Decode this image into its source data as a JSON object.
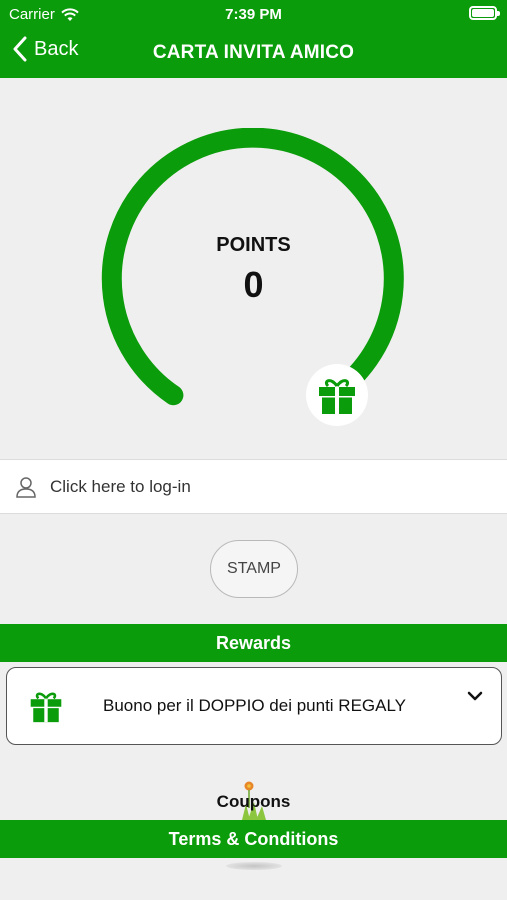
{
  "status_bar": {
    "carrier": "Carrier",
    "time": "7:39 PM"
  },
  "nav": {
    "back_label": "Back",
    "title": "CARTA INVITA AMICO"
  },
  "points": {
    "label": "POINTS",
    "value": "0"
  },
  "login": {
    "label": "Click here to log-in"
  },
  "stamp": {
    "label": "STAMP"
  },
  "rewards": {
    "header": "Rewards",
    "items": [
      {
        "label": "Buono per il DOPPIO dei punti REGALY"
      }
    ]
  },
  "coupons": {
    "label": "Coupons"
  },
  "terms": {
    "label": "Terms & Conditions"
  },
  "colors": {
    "brand_green": "#0a9c0a",
    "background": "#f0efef"
  }
}
